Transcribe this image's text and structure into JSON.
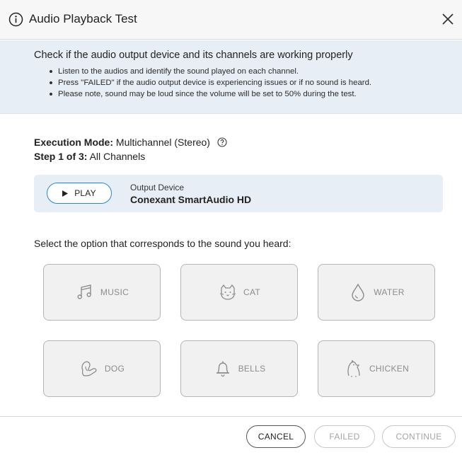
{
  "dialog": {
    "title": "Audio Playback Test"
  },
  "intro": {
    "heading": "Check if the audio output device and its channels are working properly",
    "bullets": [
      "Listen to the audios and identify the sound played on each channel.",
      "Press \"FAILED\" if the audio output device is experiencing issues or if no sound is heard.",
      "Please note, sound may be loud since the volume will be set to 50% during the test."
    ]
  },
  "mode": {
    "label": "Execution Mode:",
    "value": "Multichannel (Stereo)"
  },
  "step": {
    "label": "Step 1 of 3:",
    "value": "All Channels"
  },
  "device": {
    "play_label": "PLAY",
    "caption": "Output Device",
    "name": "Conexant SmartAudio HD"
  },
  "prompt": "Select the option that corresponds to the sound you heard:",
  "options": [
    {
      "label": "MUSIC",
      "icon": "music-note-icon"
    },
    {
      "label": "CAT",
      "icon": "cat-icon"
    },
    {
      "label": "WATER",
      "icon": "water-drop-icon"
    },
    {
      "label": "DOG",
      "icon": "dog-icon"
    },
    {
      "label": "BELLS",
      "icon": "bell-icon"
    },
    {
      "label": "CHICKEN",
      "icon": "chicken-icon"
    }
  ],
  "footer": {
    "cancel": "CANCEL",
    "failed": "FAILED",
    "continue": "CONTINUE"
  },
  "colors": {
    "accent": "#1e88e5",
    "panel_bg": "#e8eef6",
    "option_bg": "#f1f1f1"
  }
}
